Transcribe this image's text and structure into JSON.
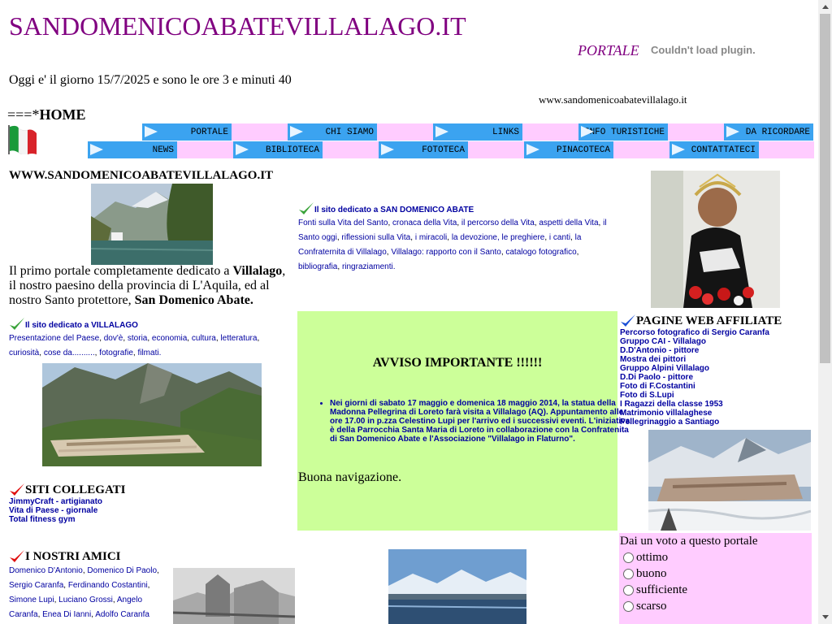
{
  "header": {
    "site_title": "SANDOMENICOABATEVILLALAGO.IT",
    "portale": "PORTALE",
    "plugin_msg": "Couldn't load plugin.",
    "date_line": "Oggi e' il giorno 15/7/2025 e sono le ore 3 e minuti 40",
    "domain_small": "www.sandomenicoabatevillalago.it",
    "home_prefix": "===*",
    "home_label": "HOME"
  },
  "nav": {
    "row1": [
      "PORTALE",
      "CHI SIAMO",
      "LINKS",
      "INFO TURISTICHE",
      "DA RICORDARE"
    ],
    "row2": [
      "NEWS",
      "BIBLIOTECA",
      "FOTOTECA",
      "PINACOTECA",
      "CONTATTATECI"
    ]
  },
  "left": {
    "heading": "WWW.SANDOMENICOABATEVILLALAGO.IT",
    "intro_a": "Il primo portale completamente dedicato a ",
    "intro_b": "Villalago",
    "intro_c": ", il nostro paesino della provincia di L'Aquila, ed al nostro Santo protettore, ",
    "intro_d": "San Domenico Abate.",
    "villalago_title": "Il sito dedicato a VILLALAGO",
    "villalago_links": [
      "Presentazione del Paese",
      "dov'è",
      "storia",
      "economia",
      "cultura",
      "letteratura",
      "curiosità",
      "cose da..........",
      "fotografie",
      "filmati."
    ],
    "siti_title": "SITI COLLEGATI",
    "siti_links": [
      "JimmyCraft - artigianato",
      "Vita di Paese - giornale",
      "Total fitness gym"
    ],
    "amici_title": "I NOSTRI AMICI",
    "amici_links": [
      "Domenico D'Antonio",
      "Domenico Di Paolo",
      "Sergio Caranfa",
      "Ferdinando Costantini",
      "Simone Lupi",
      "Luciano Grossi",
      "Angelo Caranfa",
      "Enea Di Ianni",
      "Adolfo Caranfa"
    ]
  },
  "middle": {
    "sandomenico_title": "Il sito dedicato a SAN DOMENICO ABATE",
    "sandomenico_links": [
      "Fonti sulla Vita del Santo",
      "cronaca della Vita",
      "il percorso della Vita",
      "aspetti della Vita",
      "il Santo oggi",
      "riflessioni sulla Vita",
      "i miracoli",
      "la devozione, le preghiere",
      "i canti",
      "la Confraternita di Villalago",
      "Villalago: rapporto con il Santo",
      "catalogo fotografico",
      "bibliografia",
      "ringraziamenti."
    ],
    "avviso_title": "AVVISO IMPORTANTE !!!!!!",
    "avviso_text": "Nei giorni di sabato 17 maggio e domenica 18 maggio 2014, la statua della Madonna Pellegrina di Loreto farà visita a Villalago (AQ). Appuntamento alle ore 17.00 in p.zza Celestino Lupi per l'arrivo ed i successivi eventi. L'iniziativa è della Parrocchia Santa Maria di Loreto in collaborazione con la Confratenita di San Domenico Abate e l'Associazione \"Villalago in Flaturno\".",
    "buona": "Buona navigazione."
  },
  "right": {
    "affiliate_title": "PAGINE WEB AFFILIATE",
    "affiliate_links": [
      "Percorso fotografico di Sergio Caranfa",
      "Gruppo CAI - Villalago",
      "D.D'Antonio - pittore",
      "Mostra dei pittori",
      "Gruppo Alpini Villalago",
      "D.Di Paolo - pittore",
      "Foto di F.Costantini",
      "Foto di S.Lupi",
      "I Ragazzi della classe 1953",
      "Matrimonio villalaghese",
      "Pellegrinaggio a Santiago"
    ],
    "voto_title": "Dai un voto a questo portale",
    "voto_options": [
      "ottimo",
      "buono",
      "sufficiente",
      "scarso"
    ]
  },
  "colors": {
    "title_purple": "#800080",
    "nav_blue": "#3ba3f0",
    "nav_pink": "#ffccff",
    "avviso_green": "#ccff99",
    "link_blue": "#0000a0"
  }
}
